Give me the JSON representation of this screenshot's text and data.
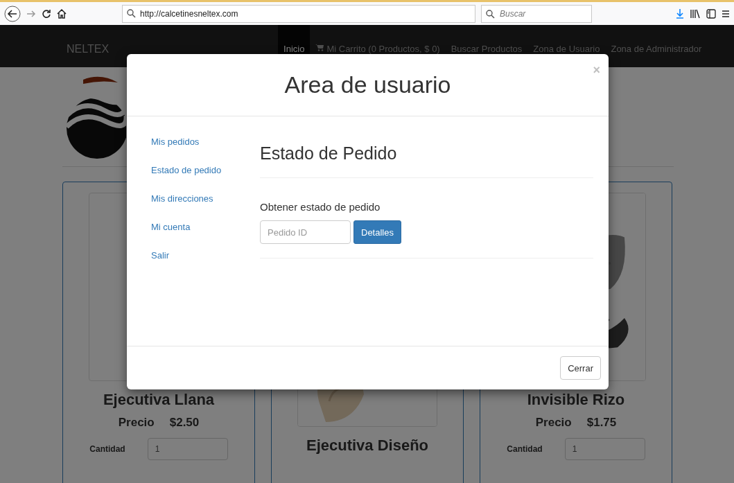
{
  "browser": {
    "url": "http://calcetinesneltex.com",
    "search": {
      "placeholder": "Buscar"
    }
  },
  "navbar": {
    "brand": "NELTEX",
    "items": [
      {
        "label": "Inicio",
        "selected": true,
        "kind": "link"
      },
      {
        "label": "Mi Carrito (0 Productos, $ 0)",
        "selected": false,
        "kind": "cart"
      },
      {
        "label": "Buscar Productos",
        "selected": false,
        "kind": "link"
      },
      {
        "label": "Zona de Usuario",
        "selected": false,
        "kind": "link"
      },
      {
        "label": "Zona de Administrador",
        "selected": false,
        "kind": "link"
      }
    ]
  },
  "products": [
    {
      "name": "Ejecutiva Llana",
      "price_label": "Precio",
      "price": "$2.50",
      "quantity_label": "Cantidad",
      "quantity": "1"
    },
    {
      "name": "Ejecutiva Diseño",
      "picture": true
    },
    {
      "name": "Invisible Rizo",
      "price_label": "Precio",
      "price": "$1.75",
      "quantity_label": "Cantidad",
      "quantity": "1",
      "picture": true
    }
  ],
  "modal": {
    "title": "Area de usuario",
    "close": "×",
    "menu": [
      "Mis pedidos",
      "Estado de pedido",
      "Mis direcciones",
      "Mi cuenta",
      "Salir"
    ],
    "section_title": "Estado de Pedido",
    "form_label": "Obtener estado de pedido",
    "order_field": {
      "placeholder": "Pedido ID"
    },
    "submit": "Detalles",
    "footer_button": "Cerrar"
  }
}
